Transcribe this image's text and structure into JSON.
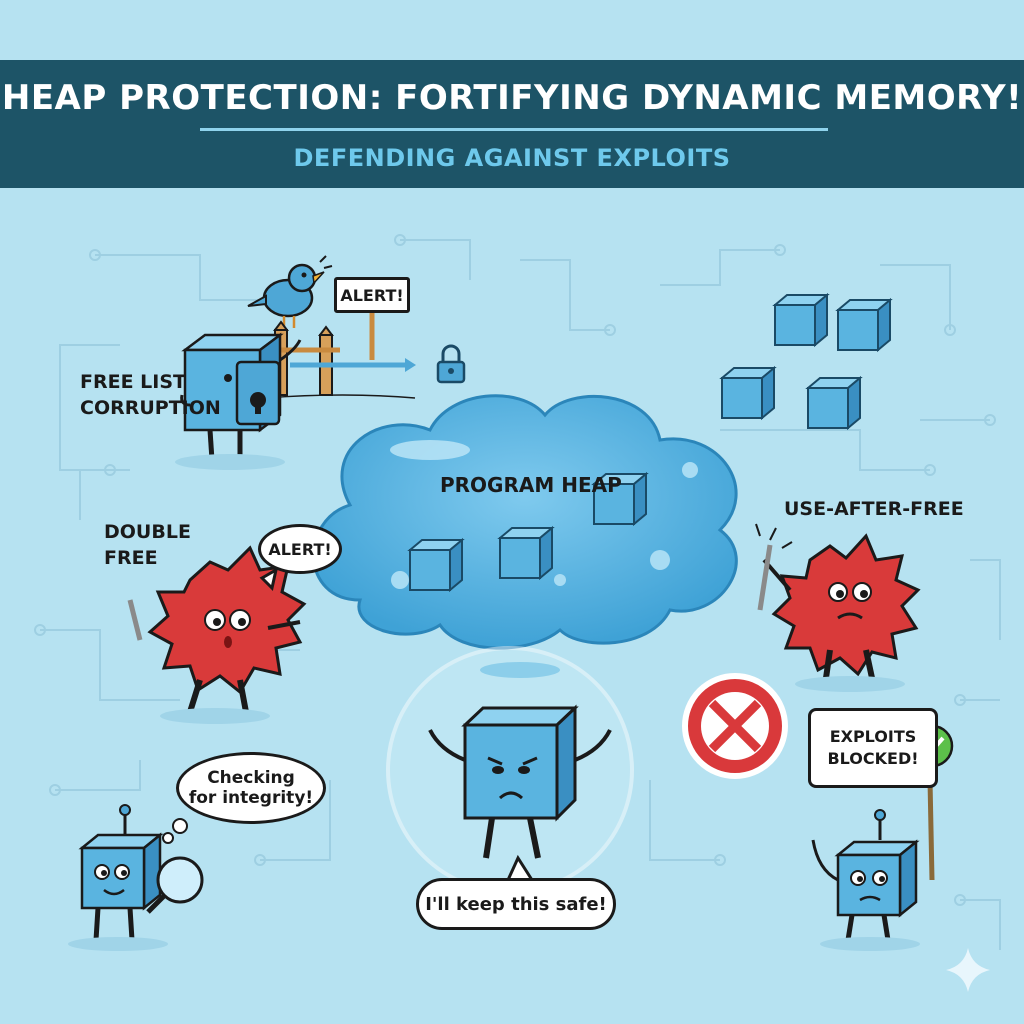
{
  "header": {
    "title": "HEAP PROTECTION: FORTIFYING DYNAMIC MEMORY!",
    "subtitle": "DEFENDING AGAINST EXPLOITS"
  },
  "labels": {
    "free_list_line1": "FREE LIST",
    "free_list_line2": "CORRUPTION",
    "double_free_line1": "DOUBLE",
    "double_free_line2": "FREE",
    "use_after_free": "USE-AFTER-FREE",
    "program_heap": "PROGRAM HEAP"
  },
  "bubbles": {
    "bird_alert": "ALERT!",
    "double_free_alert": "ALERT!",
    "checking_line1": "Checking",
    "checking_line2": "for integrity!",
    "keep_safe": "I'll keep this safe!",
    "exploits_line1": "EXPLOITS",
    "exploits_line2": "BLOCKED!"
  },
  "icons": {
    "bird": "bird-icon",
    "padlock": "padlock-icon",
    "block": "blocked-x-icon",
    "check": "checkmark-icon",
    "sparkle": "sparkle-icon"
  },
  "colors": {
    "background": "#b6e2f1",
    "banner": "#1d5467",
    "subtitle": "#6ec9ec",
    "cube": "#4ea7d6",
    "threat": "#d93a3a",
    "heap_cloud": "#5bb6e0",
    "block_red": "#d9393b",
    "check_green": "#5cc04a"
  }
}
